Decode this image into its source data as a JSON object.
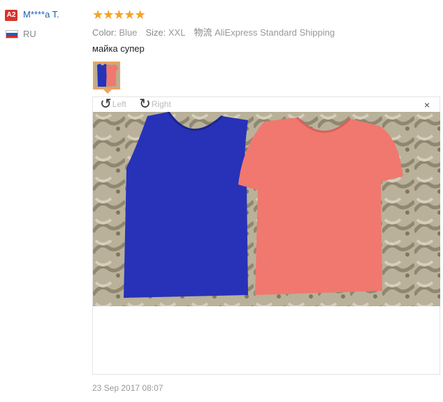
{
  "user": {
    "level_badge": "A2",
    "name": "M****a T.",
    "country_code": "RU",
    "flag_colors": [
      "#ffffff",
      "#2b57b8",
      "#d52b1e"
    ]
  },
  "review": {
    "stars": "★★★★★",
    "rating": 5,
    "attributes": {
      "color_label": "Color:",
      "color_value": "Blue",
      "size_label": "Size:",
      "size_value": "XXL",
      "shipping_label": "物流",
      "shipping_value": "AliExpress Standard Shipping"
    },
    "text": "майка супер",
    "date": "23 Sep 2017 08:07"
  },
  "viewer": {
    "rotate_left_icon": "↺",
    "rotate_left_label": "Left",
    "rotate_right_icon": "↻",
    "rotate_right_label": "Right",
    "close_icon": "×"
  },
  "colors": {
    "star": "#f7a124",
    "username": "#1b5fb0",
    "badge": "#d8342b",
    "thumb_border": "#f0a35a",
    "shirt_blue": "#2732b8",
    "shirt_pink": "#f0786f"
  }
}
